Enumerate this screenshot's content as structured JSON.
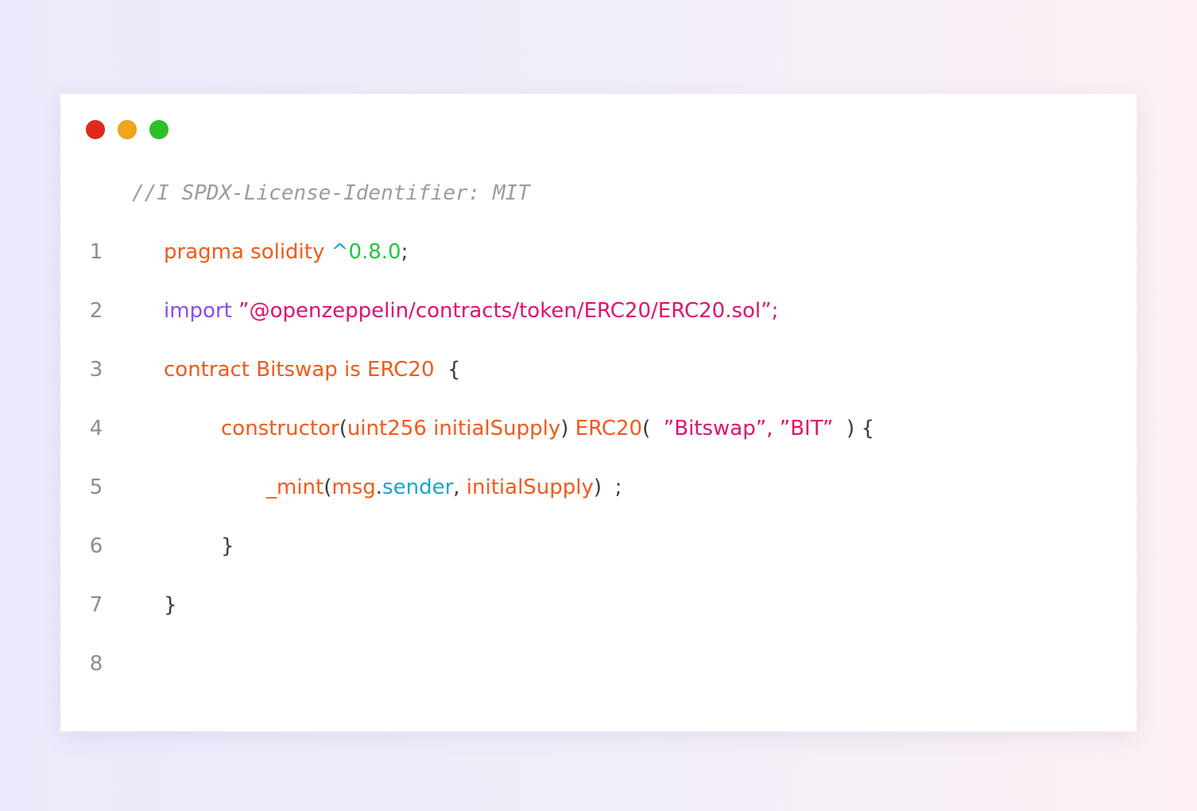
{
  "colors": {
    "keyword": "#f3591b",
    "version": "#1fc83a",
    "caret": "#14a6cf",
    "import": "#8a4cf0",
    "string": "#dd1272",
    "comment": "#9b9ba2",
    "line_number": "#8c8c93",
    "punct": "#3a3a44"
  },
  "lines": [
    {
      "number": "1",
      "comment": "//I SPDX-License-Identifier: MIT"
    },
    {
      "number": "2",
      "pragma": "pragma solidity",
      "caret": "^",
      "version": "0.8.0",
      "semi": ";"
    },
    {
      "number": "3",
      "keyword": "import",
      "path": "”@openzeppelin/contracts/token/ERC20/ERC20.sol”;"
    },
    {
      "number": "4",
      "decl": "contract Bitswap is ERC20",
      "brace": "{"
    },
    {
      "number": "5",
      "ctor": "constructor",
      "open": "(",
      "params": "uint256 initialSupply",
      "close": ")",
      "base": "ERC20",
      "open2": "(",
      "name_str": "”Bitswap”",
      "comma": ",",
      "symbol_str": "”BIT”",
      "close2": ")",
      "brace": "{"
    },
    {
      "number": "6",
      "fn": "_mint",
      "open": "(",
      "obj": "msg",
      "dot": ".",
      "prop": "sender",
      "comma": ",",
      "arg": "initialSupply",
      "close": ")",
      "semi": ";"
    },
    {
      "number": "7",
      "brace": "}"
    },
    {
      "number": "8",
      "brace": "}"
    }
  ]
}
